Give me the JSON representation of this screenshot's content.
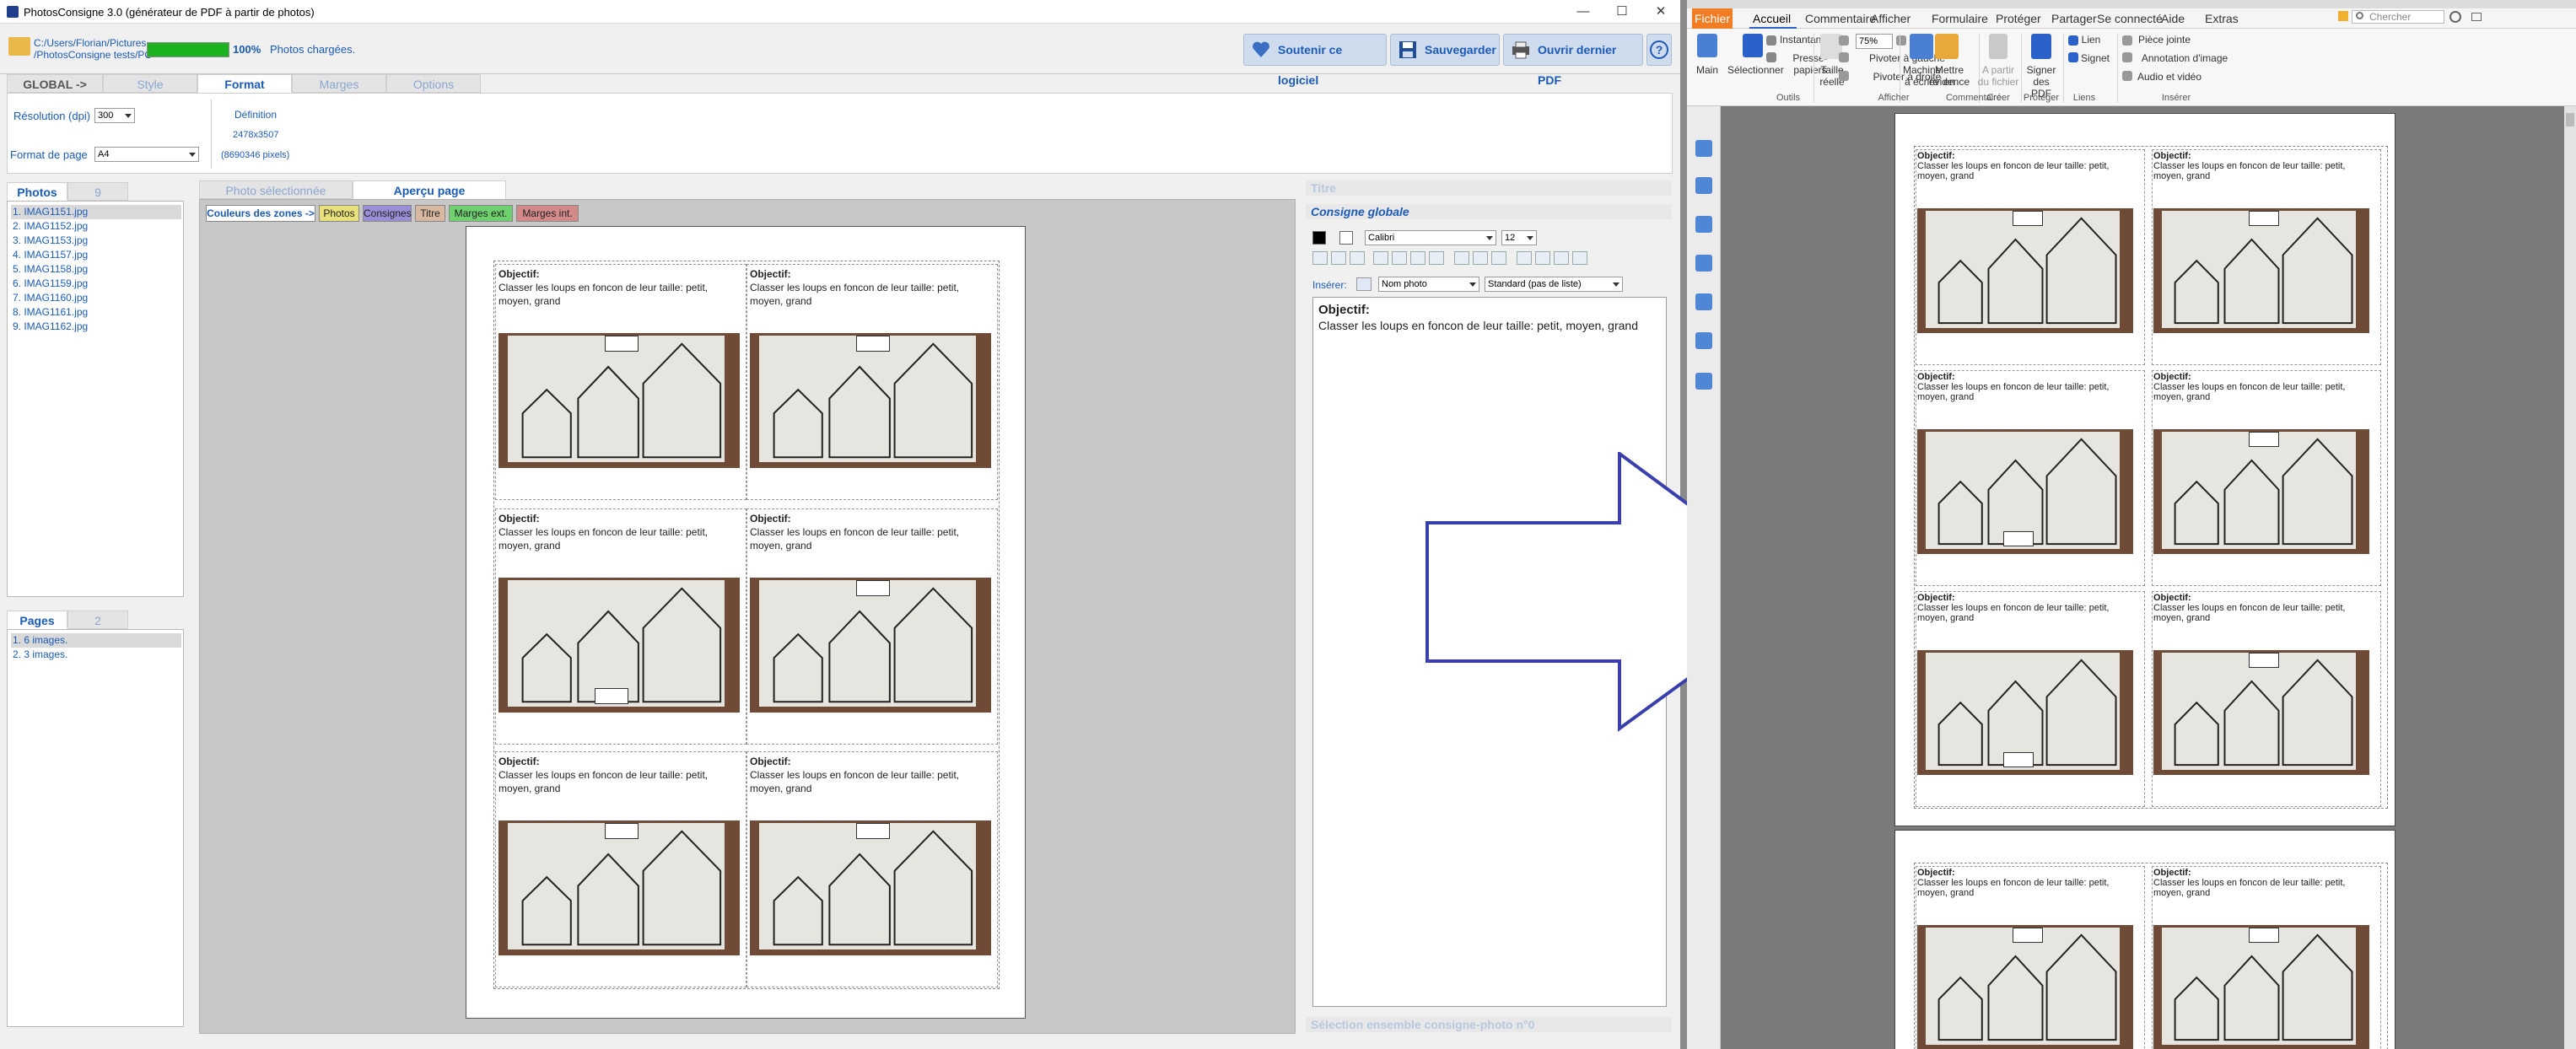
{
  "left_app": {
    "window_title": "PhotosConsigne 3.0 (générateur de PDF à partir de photos)",
    "window_controls": {
      "minimize": "—",
      "maximize": "☐",
      "close": "✕"
    },
    "path_line1": "C:/Users/Florian/Pictures",
    "path_line2": "/PhotosConsigne tests/PC",
    "progress_percent": 100,
    "progress_label": "100%",
    "status": "Photos chargées.",
    "buttons": {
      "support": "Soutenir ce logiciel",
      "save": "Sauvegarder",
      "open_last_pdf": "Ouvrir dernier PDF",
      "help": "?"
    },
    "main_tabs": [
      "GLOBAL ->",
      "Style",
      "Format",
      "Marges",
      "Options"
    ],
    "active_main_tab": "Format",
    "format": {
      "resolution_label": "Résolution (dpi)",
      "resolution_value": "300",
      "page_format_label": "Format de page",
      "page_format_value": "A4",
      "definition_label": "Définition",
      "definition_value": "2478x3507",
      "pixels_value": "(8690346 pixels)"
    },
    "photos_tabs": [
      "Photos",
      "9"
    ],
    "photos": [
      "1. IMAG1151.jpg",
      "2. IMAG1152.jpg",
      "3. IMAG1153.jpg",
      "4. IMAG1157.jpg",
      "5. IMAG1158.jpg",
      "6. IMAG1159.jpg",
      "7. IMAG1160.jpg",
      "8. IMAG1161.jpg",
      "9. IMAG1162.jpg"
    ],
    "pages_tabs": [
      "Pages",
      "2"
    ],
    "pages": [
      "1. 6 images.",
      "2. 3 images."
    ],
    "preview_tabs": [
      "Photo sélectionnée",
      "Aperçu page"
    ],
    "active_preview_tab": "Aperçu page",
    "zone_buttons": [
      {
        "label": "Couleurs des zones ->",
        "color": "#ffffff"
      },
      {
        "label": "Photos",
        "color": "#e8e07a"
      },
      {
        "label": "Consignes",
        "color": "#9a8fd6"
      },
      {
        "label": "Titre",
        "color": "#d8b8a0"
      },
      {
        "label": "Marges ext.",
        "color": "#6fd06f"
      },
      {
        "label": "Marges int.",
        "color": "#d48a8a"
      }
    ],
    "cell_heading": "Objectif:",
    "cell_body": "Classer les loups en foncon de leur taille: petit, moyen, grand",
    "right_panel": {
      "title_header": "Titre",
      "consigne_header": "Consigne globale",
      "font_name": "Calibri",
      "font_size": "12",
      "insert_label": "Insérer:",
      "insert_value": "Nom photo",
      "list_style_value": "Standard (pas de liste)",
      "editor_heading": "Objectif:",
      "editor_body": "Classer les loups en foncon de leur taille: petit, moyen, grand",
      "bottom_header": "Sélection ensemble consigne-photo n°0"
    }
  },
  "right_app": {
    "fichier": "Fichier",
    "menu": [
      "Accueil",
      "Commentaire",
      "Afficher",
      "Formulaire",
      "Protéger",
      "Partager",
      "Se connecté",
      "Aide",
      "Extras"
    ],
    "active_menu": "Accueil",
    "search_placeholder": "Chercher",
    "ribbon": {
      "main": "Main",
      "select": "Sélectionner",
      "snapshot": "Instantané",
      "clipboard": "Presse-papiers",
      "real_size_1": "Taille",
      "real_size_2": "réelle",
      "zoom": "75%",
      "rotate_left": "Pivoter à gauche",
      "rotate_right": "Pivoter à droite",
      "typewriter_1": "Machine",
      "typewriter_2": "à écrire",
      "highlight_1": "Mettre en",
      "highlight_2": "évidence",
      "from_file_1": "A partir",
      "from_file_2": "du fichier",
      "sign_1": "Signer",
      "sign_2": "des PDF",
      "link": "Lien",
      "signet": "Signet",
      "attachment": "Pièce jointe",
      "image_annot": "Annotation d'image",
      "audio_video": "Audio et vidéo",
      "groups": [
        "Outils",
        "Afficher",
        "Commentaire",
        "Créer",
        "Protéger",
        "Liens",
        "Insérer"
      ]
    },
    "cell_heading": "Objectif:",
    "cell_body_line1": "Classer les loups en foncon de leur taille: petit,",
    "cell_body_line2": "moyen, grand"
  }
}
